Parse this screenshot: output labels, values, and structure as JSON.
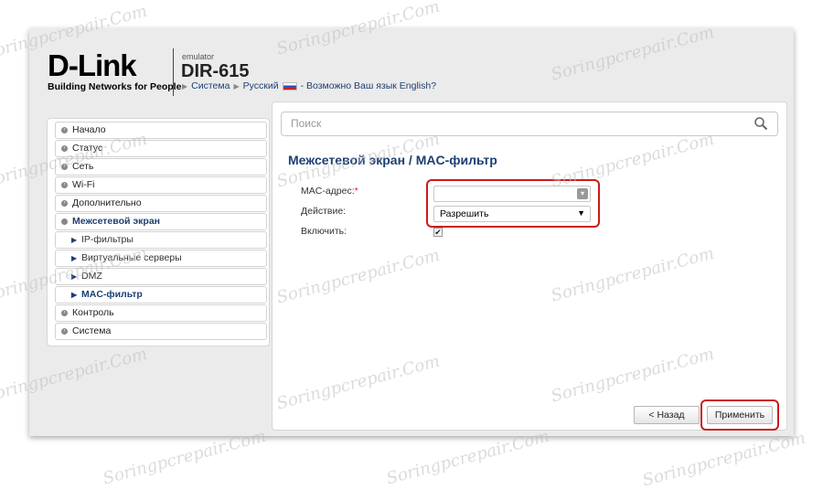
{
  "header": {
    "logo": "D-Link",
    "tagline": "Building Networks for People",
    "emulator_label": "emulator",
    "model": "DIR-615",
    "links": [
      {
        "label": "Система"
      },
      {
        "label": "Русский"
      },
      {
        "label": "- Возможно Ваш язык English?"
      }
    ]
  },
  "sidebar": {
    "items": [
      {
        "label": "Начало",
        "kind": "top"
      },
      {
        "label": "Статус",
        "kind": "top"
      },
      {
        "label": "Сеть",
        "kind": "top"
      },
      {
        "label": "Wi-Fi",
        "kind": "top"
      },
      {
        "label": "Дополнительно",
        "kind": "top"
      },
      {
        "label": "Межсетевой экран",
        "kind": "open"
      },
      {
        "label": "IP-фильтры",
        "kind": "sub"
      },
      {
        "label": "Виртуальные серверы",
        "kind": "sub"
      },
      {
        "label": "DMZ",
        "kind": "sub"
      },
      {
        "label": "MAC-фильтр",
        "kind": "sub-active"
      },
      {
        "label": "Контроль",
        "kind": "top"
      },
      {
        "label": "Система",
        "kind": "top"
      }
    ]
  },
  "search": {
    "placeholder": "Поиск"
  },
  "page": {
    "title": "Межсетевой экран /  MAC-фильтр",
    "fields": {
      "mac_label": "MAC-адрес:",
      "mac_required": "*",
      "mac_value": "",
      "action_label": "Действие:",
      "action_value": "Разрешить",
      "enable_label": "Включить:",
      "enable_checked": true
    }
  },
  "buttons": {
    "back": "< Назад",
    "apply": "Применить"
  },
  "watermark": "Soringpcrepair.Com",
  "colors": {
    "accent": "#1d3f72",
    "highlight": "#cc1a1a",
    "required": "#d8202f"
  }
}
